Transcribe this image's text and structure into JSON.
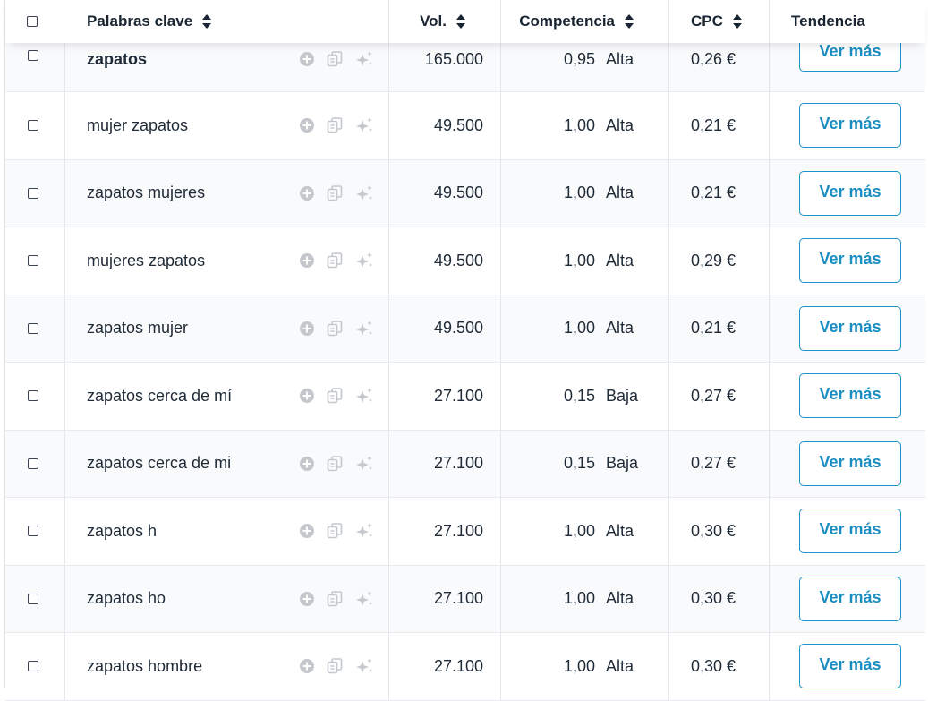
{
  "header": {
    "keywords": "Palabras clave",
    "volume": "Vol.",
    "competition": "Competencia",
    "cpc": "CPC",
    "trend": "Tendencia"
  },
  "icons": {
    "sort": "sort-updown-icon",
    "add": "plus-circle-icon",
    "copy": "copy-icon",
    "ai": "sparkle-icon"
  },
  "colors": {
    "accent": "#1a8dc1",
    "icon_gray": "#c4c8cd",
    "row_alt": "#f9fafb"
  },
  "rows": [
    {
      "keyword": "zapatos",
      "volume": "165.000",
      "comp": "0,95",
      "level": "Alta",
      "cpc": "0,26 €",
      "action": "Ver más"
    },
    {
      "keyword": "mujer zapatos",
      "volume": "49.500",
      "comp": "1,00",
      "level": "Alta",
      "cpc": "0,21 €",
      "action": "Ver más"
    },
    {
      "keyword": "zapatos mujeres",
      "volume": "49.500",
      "comp": "1,00",
      "level": "Alta",
      "cpc": "0,21 €",
      "action": "Ver más"
    },
    {
      "keyword": "mujeres zapatos",
      "volume": "49.500",
      "comp": "1,00",
      "level": "Alta",
      "cpc": "0,29 €",
      "action": "Ver más"
    },
    {
      "keyword": "zapatos mujer",
      "volume": "49.500",
      "comp": "1,00",
      "level": "Alta",
      "cpc": "0,21 €",
      "action": "Ver más"
    },
    {
      "keyword": "zapatos cerca de mí",
      "volume": "27.100",
      "comp": "0,15",
      "level": "Baja",
      "cpc": "0,27 €",
      "action": "Ver más"
    },
    {
      "keyword": "zapatos cerca de mi",
      "volume": "27.100",
      "comp": "0,15",
      "level": "Baja",
      "cpc": "0,27 €",
      "action": "Ver más"
    },
    {
      "keyword": "zapatos h",
      "volume": "27.100",
      "comp": "1,00",
      "level": "Alta",
      "cpc": "0,30 €",
      "action": "Ver más"
    },
    {
      "keyword": "zapatos ho",
      "volume": "27.100",
      "comp": "1,00",
      "level": "Alta",
      "cpc": "0,30 €",
      "action": "Ver más"
    },
    {
      "keyword": "zapatos hombre",
      "volume": "27.100",
      "comp": "1,00",
      "level": "Alta",
      "cpc": "0,30 €",
      "action": "Ver más"
    }
  ]
}
